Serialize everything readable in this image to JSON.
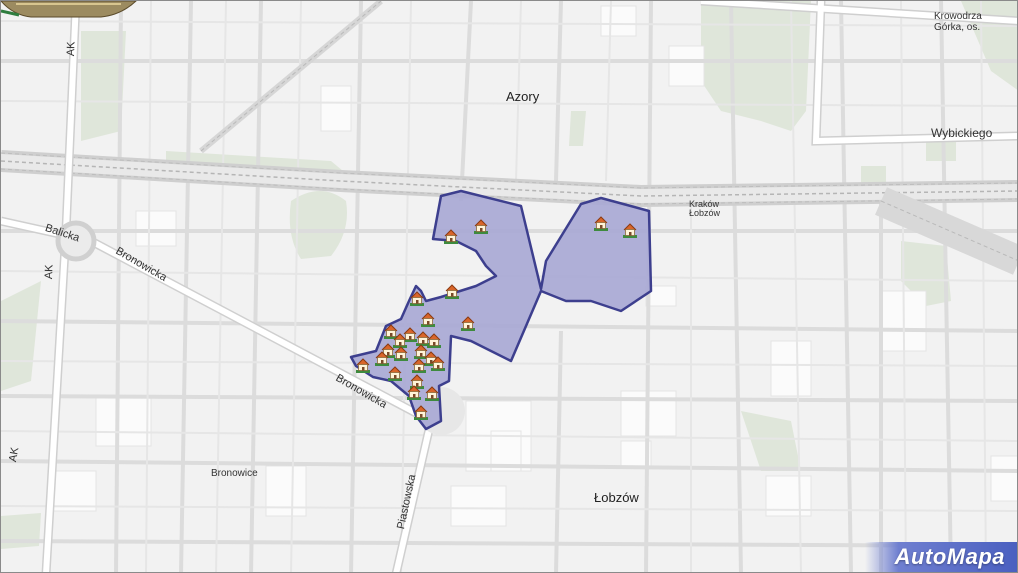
{
  "map": {
    "places": [
      {
        "text": "Azory"
      },
      {
        "text": "Łobzów"
      },
      {
        "text": "Bronowice"
      },
      {
        "text": "Krowodrza Górka, os."
      },
      {
        "text": "Kraków Łobzów"
      }
    ],
    "streets": [
      {
        "text": "Wybickiego"
      },
      {
        "text": "Balicka"
      },
      {
        "text": "Bronowicka"
      },
      {
        "text": "Bronowicka"
      },
      {
        "text": "Piastowska"
      },
      {
        "text": "AK"
      },
      {
        "text": "AK"
      },
      {
        "text": "AK"
      }
    ],
    "markers": {
      "icon": "house-icon",
      "count": 26
    },
    "region": {
      "fill": "#a7a7d4",
      "stroke": "#3d3f8e"
    }
  },
  "brand": {
    "text": "AutoMapa"
  }
}
